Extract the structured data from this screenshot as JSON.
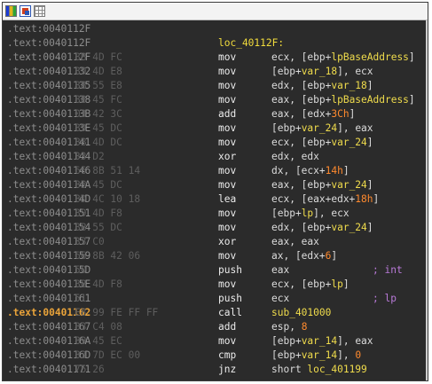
{
  "toolbar": {
    "icons": [
      "colors-icon",
      "graph-view-icon",
      "grid-icon"
    ]
  },
  "colors": {
    "background": "#2b2b2b",
    "address": "#8d8d8d",
    "address_current": "#e9a33a",
    "label": "#f2dc3c",
    "mnemonic": "#ececec",
    "identifier": "#f0dc4c",
    "number": "#ff8a2e",
    "comment": "#b97ad8"
  },
  "lines": [
    {
      "addr": ".text:0040112F",
      "bytes": "",
      "label": "",
      "mnem": "",
      "ops": [],
      "comment": ""
    },
    {
      "addr": ".text:0040112F",
      "bytes": "",
      "label": "loc_40112F:",
      "mnem": "",
      "ops": [],
      "comment": ""
    },
    {
      "addr": ".text:0040112F",
      "bytes": "8B 4D FC",
      "mnem": "mov",
      "ops": [
        [
          "p",
          "ecx, [ebp+"
        ],
        [
          "i",
          "lpBaseAddress"
        ],
        [
          "p",
          "]"
        ]
      ],
      "comment": ""
    },
    {
      "addr": ".text:00401132",
      "bytes": "89 4D E8",
      "mnem": "mov",
      "ops": [
        [
          "p",
          "[ebp+"
        ],
        [
          "i",
          "var_18"
        ],
        [
          "p",
          "], ecx"
        ]
      ],
      "comment": ""
    },
    {
      "addr": ".text:00401135",
      "bytes": "8B 55 E8",
      "mnem": "mov",
      "ops": [
        [
          "p",
          "edx, [ebp+"
        ],
        [
          "i",
          "var_18"
        ],
        [
          "p",
          "]"
        ]
      ],
      "comment": ""
    },
    {
      "addr": ".text:00401138",
      "bytes": "8B 45 FC",
      "mnem": "mov",
      "ops": [
        [
          "p",
          "eax, [ebp+"
        ],
        [
          "i",
          "lpBaseAddress"
        ],
        [
          "p",
          "]"
        ]
      ],
      "comment": ""
    },
    {
      "addr": ".text:0040113B",
      "bytes": "03 42 3C",
      "mnem": "add",
      "ops": [
        [
          "p",
          "eax, [edx+"
        ],
        [
          "n",
          "3Ch"
        ],
        [
          "p",
          "]"
        ]
      ],
      "comment": ""
    },
    {
      "addr": ".text:0040113E",
      "bytes": "89 45 DC",
      "mnem": "mov",
      "ops": [
        [
          "p",
          "[ebp+"
        ],
        [
          "i",
          "var_24"
        ],
        [
          "p",
          "], eax"
        ]
      ],
      "comment": ""
    },
    {
      "addr": ".text:00401141",
      "bytes": "8B 4D DC",
      "mnem": "mov",
      "ops": [
        [
          "p",
          "ecx, [ebp+"
        ],
        [
          "i",
          "var_24"
        ],
        [
          "p",
          "]"
        ]
      ],
      "comment": ""
    },
    {
      "addr": ".text:00401144",
      "bytes": "33 D2",
      "mnem": "xor",
      "ops": [
        [
          "p",
          "edx, edx"
        ]
      ],
      "comment": ""
    },
    {
      "addr": ".text:00401146",
      "bytes": "66 8B 51 14",
      "mnem": "mov",
      "ops": [
        [
          "p",
          "dx, [ecx+"
        ],
        [
          "n",
          "14h"
        ],
        [
          "p",
          "]"
        ]
      ],
      "comment": ""
    },
    {
      "addr": ".text:0040114A",
      "bytes": "8B 45 DC",
      "mnem": "mov",
      "ops": [
        [
          "p",
          "eax, [ebp+"
        ],
        [
          "i",
          "var_24"
        ],
        [
          "p",
          "]"
        ]
      ],
      "comment": ""
    },
    {
      "addr": ".text:0040114D",
      "bytes": "8D 4C 10 18",
      "mnem": "lea",
      "ops": [
        [
          "p",
          "ecx, [eax+edx+"
        ],
        [
          "n",
          "18h"
        ],
        [
          "p",
          "]"
        ]
      ],
      "comment": ""
    },
    {
      "addr": ".text:00401151",
      "bytes": "89 4D F8",
      "mnem": "mov",
      "ops": [
        [
          "p",
          "[ebp+"
        ],
        [
          "i",
          "lp"
        ],
        [
          "p",
          "], ecx"
        ]
      ],
      "comment": ""
    },
    {
      "addr": ".text:00401154",
      "bytes": "8B 55 DC",
      "mnem": "mov",
      "ops": [
        [
          "p",
          "edx, [ebp+"
        ],
        [
          "i",
          "var_24"
        ],
        [
          "p",
          "]"
        ]
      ],
      "comment": ""
    },
    {
      "addr": ".text:00401157",
      "bytes": "33 C0",
      "mnem": "xor",
      "ops": [
        [
          "p",
          "eax, eax"
        ]
      ],
      "comment": ""
    },
    {
      "addr": ".text:00401159",
      "bytes": "66 8B 42 06",
      "mnem": "mov",
      "ops": [
        [
          "p",
          "ax, [edx+"
        ],
        [
          "n",
          "6"
        ],
        [
          "p",
          "]"
        ]
      ],
      "comment": ""
    },
    {
      "addr": ".text:0040115D",
      "bytes": "50",
      "mnem": "push",
      "ops": [
        [
          "p",
          "eax"
        ]
      ],
      "comment": "; int"
    },
    {
      "addr": ".text:0040115E",
      "bytes": "8B 4D F8",
      "mnem": "mov",
      "ops": [
        [
          "p",
          "ecx, [ebp+"
        ],
        [
          "i",
          "lp"
        ],
        [
          "p",
          "]"
        ]
      ],
      "comment": ""
    },
    {
      "addr": ".text:00401161",
      "bytes": "51",
      "mnem": "push",
      "ops": [
        [
          "p",
          "ecx"
        ]
      ],
      "comment": "; lp"
    },
    {
      "addr": ".text:00401162",
      "bytes": "E8 99 FE FF FF",
      "mnem": "call",
      "ops": [
        [
          "i",
          "sub_401000"
        ]
      ],
      "comment": "",
      "current": true
    },
    {
      "addr": ".text:00401167",
      "bytes": "83 C4 08",
      "mnem": "add",
      "ops": [
        [
          "p",
          "esp, "
        ],
        [
          "n",
          "8"
        ]
      ],
      "comment": ""
    },
    {
      "addr": ".text:0040116A",
      "bytes": "89 45 EC",
      "mnem": "mov",
      "ops": [
        [
          "p",
          "[ebp+"
        ],
        [
          "i",
          "var_14"
        ],
        [
          "p",
          "], eax"
        ]
      ],
      "comment": ""
    },
    {
      "addr": ".text:0040116D",
      "bytes": "83 7D EC 00",
      "mnem": "cmp",
      "ops": [
        [
          "p",
          "[ebp+"
        ],
        [
          "i",
          "var_14"
        ],
        [
          "p",
          "], "
        ],
        [
          "n",
          "0"
        ]
      ],
      "comment": ""
    },
    {
      "addr": ".text:00401171",
      "bytes": "75 26",
      "mnem": "jnz",
      "ops": [
        [
          "p",
          "short "
        ],
        [
          "i",
          "loc_401199"
        ]
      ],
      "comment": ""
    }
  ]
}
